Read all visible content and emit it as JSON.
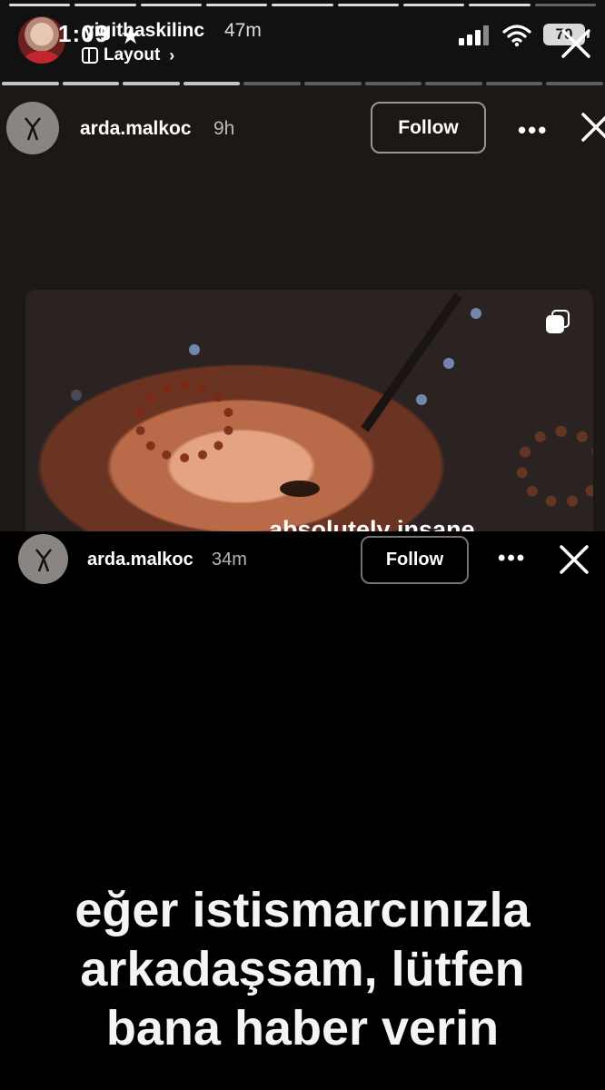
{
  "status_bar": {
    "clock": "1:09",
    "battery": "70"
  },
  "outer_story": {
    "username": "yigithaskilinc",
    "time": "47m",
    "layout_label": "Layout"
  },
  "middle_story": {
    "username": "arda.malkoc",
    "time": "9h",
    "follow_label": "Follow",
    "caption": "absolutely insane"
  },
  "bottom_story": {
    "username": "arda.malkoc",
    "time": "34m",
    "follow_label": "Follow",
    "text_lines": [
      "eğer istismarcınızla",
      "arkadaşsam, lütfen",
      "bana haber verin"
    ]
  },
  "icons": [
    "star-icon",
    "layout-icon",
    "signal-icon",
    "wifi-icon",
    "battery-icon",
    "close-icon",
    "more-icon",
    "multiple-photos-icon"
  ]
}
